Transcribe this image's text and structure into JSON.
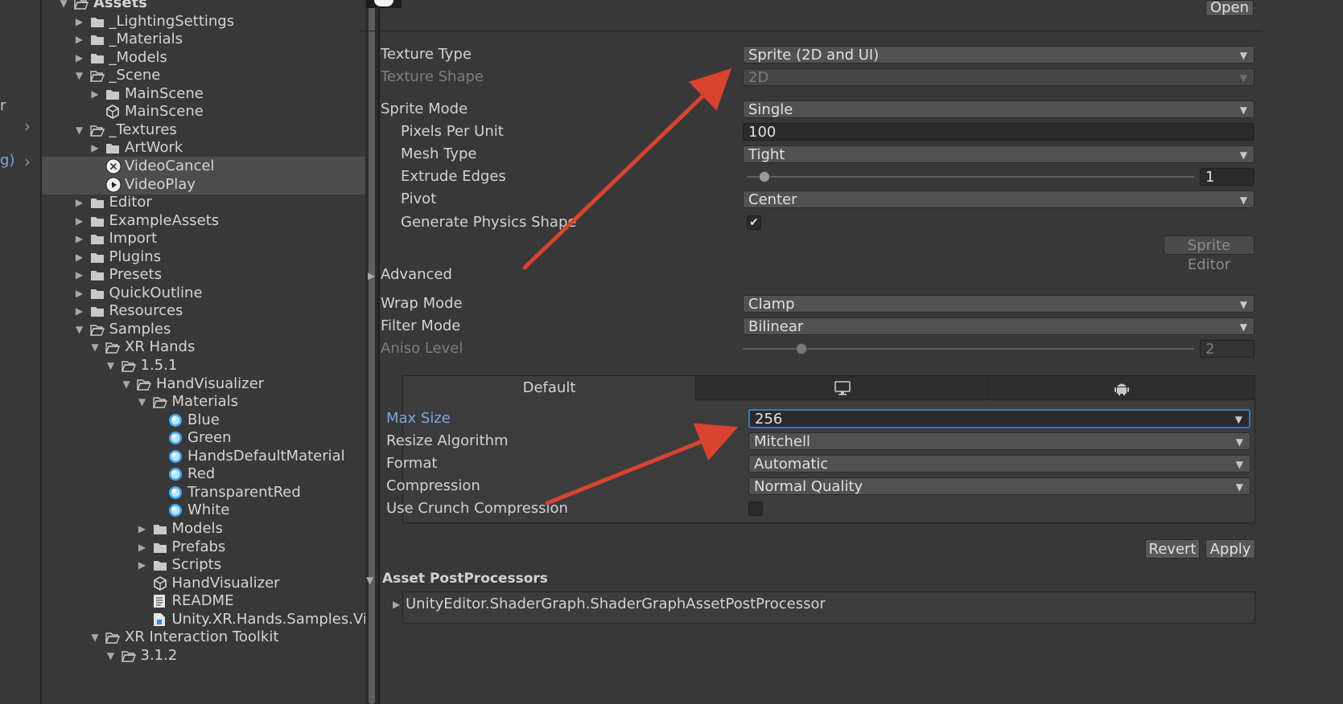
{
  "left_stub": {
    "text1": "r",
    "text2": "g)"
  },
  "tree": {
    "rows": [
      {
        "label": "Assets",
        "icon": "folder-open-icon",
        "arrow": "down"
      },
      {
        "label": "_LightingSettings",
        "icon": "folder-icon",
        "arrow": "right"
      },
      {
        "label": "_Materials",
        "icon": "folder-icon",
        "arrow": "right"
      },
      {
        "label": "_Models",
        "icon": "folder-icon",
        "arrow": "right"
      },
      {
        "label": "_Scene",
        "icon": "folder-open-icon",
        "arrow": "down"
      },
      {
        "label": "MainScene",
        "icon": "folder-icon",
        "arrow": "right"
      },
      {
        "label": "MainScene",
        "icon": "unity-scene-icon",
        "arrow": ""
      },
      {
        "label": "_Textures",
        "icon": "folder-open-icon",
        "arrow": "down"
      },
      {
        "label": "ArtWork",
        "icon": "folder-icon",
        "arrow": "right"
      },
      {
        "label": "VideoCancel",
        "icon": "cancel-circle-icon",
        "arrow": ""
      },
      {
        "label": "VideoPlay",
        "icon": "play-circle-icon",
        "arrow": ""
      },
      {
        "label": "Editor",
        "icon": "folder-icon",
        "arrow": "right"
      },
      {
        "label": "ExampleAssets",
        "icon": "folder-icon",
        "arrow": "right"
      },
      {
        "label": "Import",
        "icon": "folder-icon",
        "arrow": "right"
      },
      {
        "label": "Plugins",
        "icon": "folder-icon",
        "arrow": "right"
      },
      {
        "label": "Presets",
        "icon": "folder-icon",
        "arrow": "right"
      },
      {
        "label": "QuickOutline",
        "icon": "folder-icon",
        "arrow": "right"
      },
      {
        "label": "Resources",
        "icon": "folder-icon",
        "arrow": "right"
      },
      {
        "label": "Samples",
        "icon": "folder-open-icon",
        "arrow": "down"
      },
      {
        "label": "XR Hands",
        "icon": "folder-open-icon",
        "arrow": "down"
      },
      {
        "label": "1.5.1",
        "icon": "folder-open-icon",
        "arrow": "down"
      },
      {
        "label": "HandVisualizer",
        "icon": "folder-open-icon",
        "arrow": "down"
      },
      {
        "label": "Materials",
        "icon": "folder-open-icon",
        "arrow": "down"
      },
      {
        "label": "Blue",
        "icon": "material-icon",
        "arrow": ""
      },
      {
        "label": "Green",
        "icon": "material-icon",
        "arrow": ""
      },
      {
        "label": "HandsDefaultMaterial",
        "icon": "material-icon",
        "arrow": ""
      },
      {
        "label": "Red",
        "icon": "material-icon",
        "arrow": ""
      },
      {
        "label": "TransparentRed",
        "icon": "material-icon",
        "arrow": ""
      },
      {
        "label": "White",
        "icon": "material-icon",
        "arrow": ""
      },
      {
        "label": "Models",
        "icon": "folder-icon",
        "arrow": "right"
      },
      {
        "label": "Prefabs",
        "icon": "folder-icon",
        "arrow": "right"
      },
      {
        "label": "Scripts",
        "icon": "folder-icon",
        "arrow": "right"
      },
      {
        "label": "HandVisualizer",
        "icon": "unity-scene-icon",
        "arrow": ""
      },
      {
        "label": "README",
        "icon": "document-icon",
        "arrow": ""
      },
      {
        "label": "Unity.XR.Hands.Samples.Vis",
        "icon": "assembly-icon",
        "arrow": ""
      },
      {
        "label": "XR Interaction Toolkit",
        "icon": "folder-open-icon",
        "arrow": "down"
      },
      {
        "label": "3.1.2",
        "icon": "folder-open-icon",
        "arrow": "down"
      }
    ]
  },
  "inspector": {
    "open_button": "Open",
    "texture_type": {
      "label": "Texture Type",
      "value": "Sprite (2D and UI)"
    },
    "texture_shape": {
      "label": "Texture Shape",
      "value": "2D"
    },
    "sprite_mode": {
      "label": "Sprite Mode",
      "value": "Single"
    },
    "pixels_per_unit": {
      "label": "Pixels Per Unit",
      "value": "100"
    },
    "mesh_type": {
      "label": "Mesh Type",
      "value": "Tight"
    },
    "extrude_edges": {
      "label": "Extrude Edges",
      "value": "1",
      "slider_fraction": 0.04
    },
    "pivot": {
      "label": "Pivot",
      "value": "Center"
    },
    "generate_physics_shape": {
      "label": "Generate Physics Shape",
      "checked": true
    },
    "sprite_editor_button": "Sprite Editor",
    "advanced": "Advanced",
    "wrap_mode": {
      "label": "Wrap Mode",
      "value": "Clamp"
    },
    "filter_mode": {
      "label": "Filter Mode",
      "value": "Bilinear"
    },
    "aniso_level": {
      "label": "Aniso Level",
      "value": "2",
      "slider_fraction": 0.13
    },
    "platform_tabs": {
      "default": "Default",
      "standalone_icon": "monitor-icon",
      "android_icon": "android-icon"
    },
    "max_size": {
      "label": "Max Size",
      "value": "256"
    },
    "resize_algorithm": {
      "label": "Resize Algorithm",
      "value": "Mitchell"
    },
    "format": {
      "label": "Format",
      "value": "Automatic"
    },
    "compression": {
      "label": "Compression",
      "value": "Normal Quality"
    },
    "use_crunch": {
      "label": "Use Crunch Compression",
      "checked": false
    },
    "revert_button": "Revert",
    "apply_button": "Apply",
    "postprocessors_header": "Asset PostProcessors",
    "postprocessor_item": "UnityEditor.ShaderGraph.ShaderGraphAssetPostProcessor"
  },
  "colors": {
    "annotation_arrow": "#d9432f",
    "focus_blue": "#3a79bb",
    "label_blue": "#7ba7e0"
  }
}
